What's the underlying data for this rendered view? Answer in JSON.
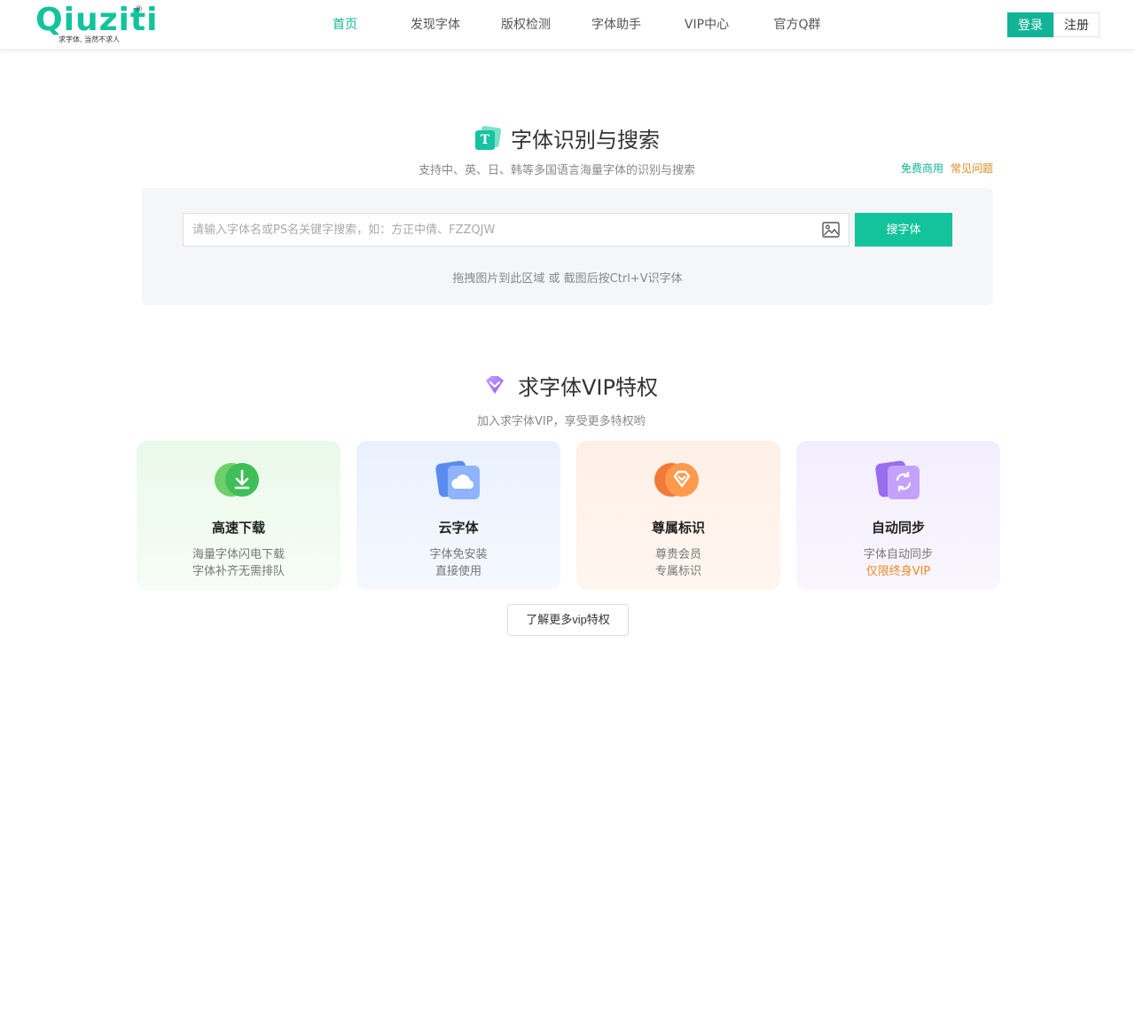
{
  "header": {
    "logo": {
      "wordmark": "Qiuziti",
      "registered": "®",
      "tagline": "求字体, 当然不求人"
    },
    "nav": [
      {
        "label": "首页",
        "active": true
      },
      {
        "label": "发现字体",
        "active": false
      },
      {
        "label": "版权检测",
        "active": false
      },
      {
        "label": "字体助手",
        "active": false
      },
      {
        "label": "VIP中心",
        "active": false
      },
      {
        "label": "官方Q群",
        "active": false
      }
    ],
    "login_label": "登录",
    "register_label": "注册"
  },
  "recognize": {
    "title": "字体识别与搜索",
    "icon_letter": "T",
    "subtitle": "支持中、英、日、韩等多国语言海量字体的识别与搜索",
    "link_free": "免费商用",
    "link_faq": "常见问题",
    "search": {
      "placeholder": "请输入字体名或PS名关键字搜索，如：方正中倩、FZZQJW",
      "value": "",
      "button_label": "搜字体"
    },
    "drag_hint": "拖拽图片到此区域 或 截图后按Ctrl+V识字体"
  },
  "vip": {
    "title": "求字体VIP特权",
    "subtitle": "加入求字体VIP，享受更多特权哟",
    "cards": [
      {
        "title": "高速下载",
        "line1": "海量字体闪电下载",
        "line2": "字体补齐无需排队",
        "icon": "download-icon",
        "theme": "green"
      },
      {
        "title": "云字体",
        "line1": "字体免安装",
        "line2": "直接使用",
        "icon": "cloud-icon",
        "theme": "blue"
      },
      {
        "title": "尊属标识",
        "line1": "尊贵会员",
        "line2": "专属标识",
        "icon": "diamond-badge-icon",
        "theme": "orange"
      },
      {
        "title": "自动同步",
        "line1": "字体自动同步",
        "line2": "仅限终身VIP",
        "icon": "sync-icon",
        "theme": "purple"
      }
    ],
    "more_label": "了解更多vip特权"
  },
  "colors": {
    "brand": "#13c39b",
    "accent_orange": "#ee8a2a",
    "link_orange": "#e08a1e"
  }
}
